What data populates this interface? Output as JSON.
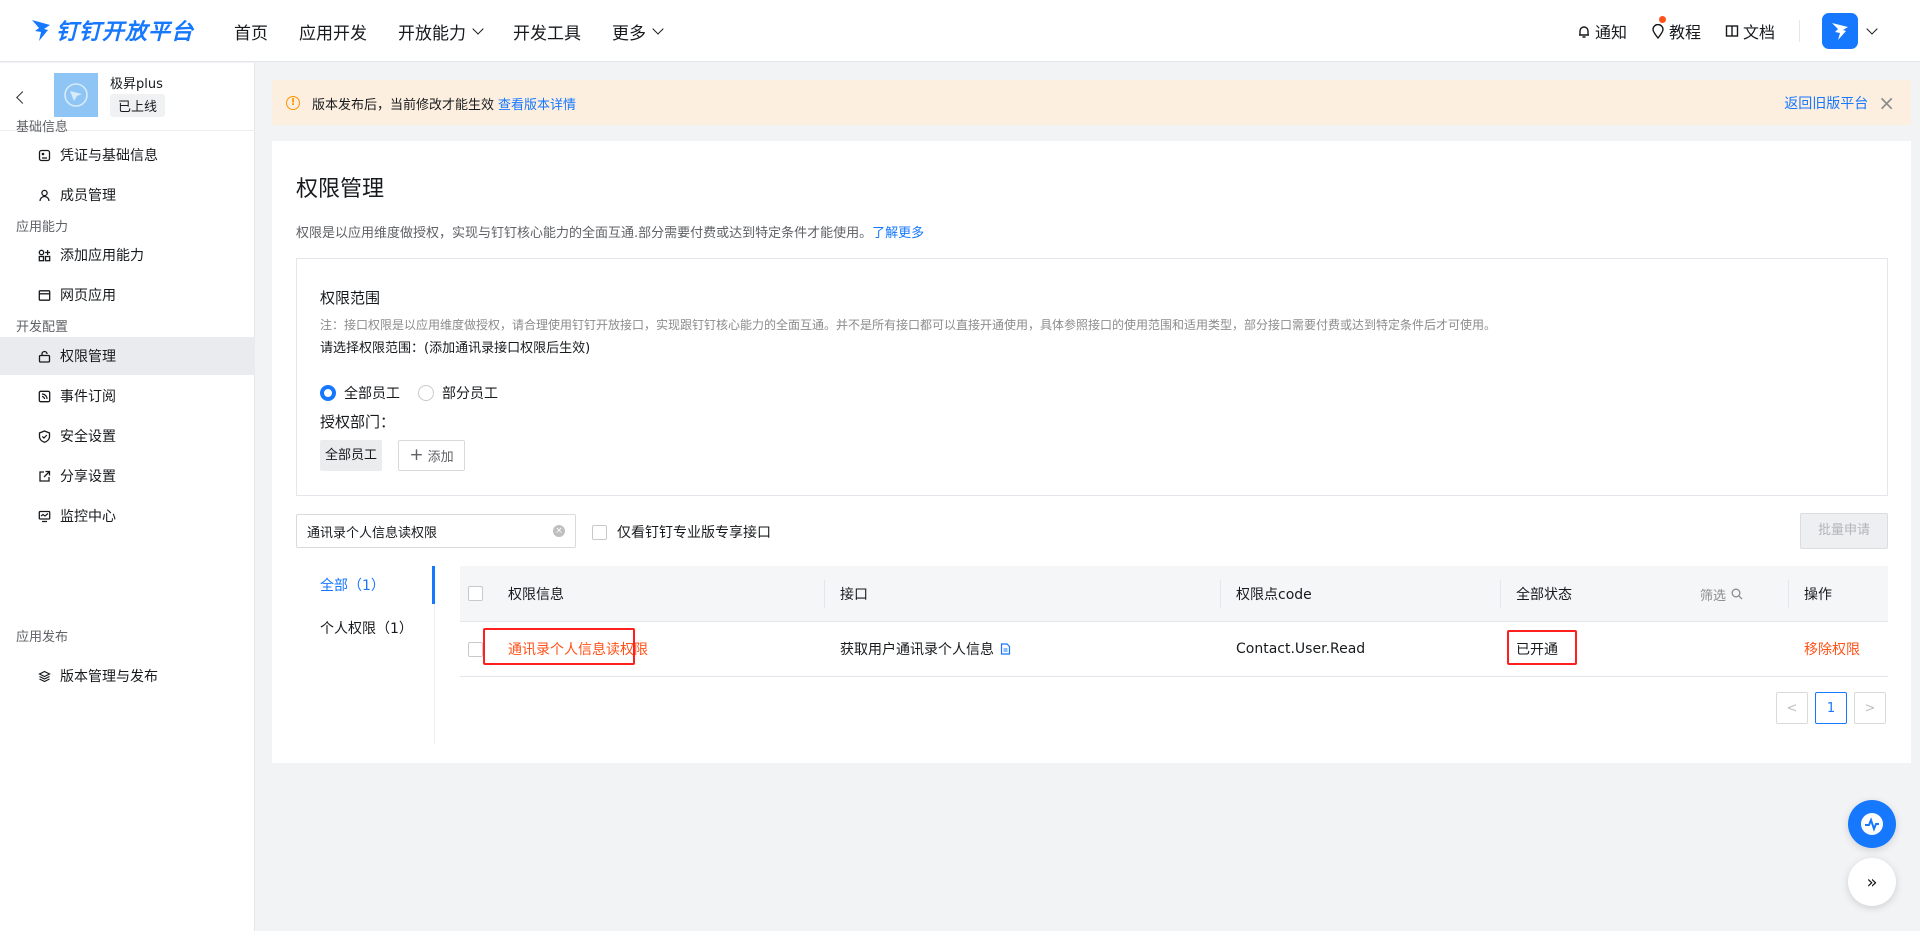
{
  "brand": {
    "name": "钉钉开放平台",
    "color": "#1677ff"
  },
  "topnav": {
    "items": [
      {
        "label": "首页",
        "has_dropdown": false
      },
      {
        "label": "应用开发",
        "has_dropdown": false
      },
      {
        "label": "开放能力",
        "has_dropdown": true
      },
      {
        "label": "开发工具",
        "has_dropdown": false
      },
      {
        "label": "更多",
        "has_dropdown": true
      }
    ],
    "right": {
      "notify": "通知",
      "tutorial": "教程",
      "docs": "文档"
    }
  },
  "sidebar": {
    "app_name": "极昇plus",
    "app_status": "已上线",
    "sections": [
      {
        "title": "基础信息",
        "items": [
          {
            "label": "凭证与基础信息",
            "icon": "credential-icon"
          },
          {
            "label": "成员管理",
            "icon": "user-icon"
          }
        ]
      },
      {
        "title": "应用能力",
        "items": [
          {
            "label": "添加应用能力",
            "icon": "apps-add-icon"
          },
          {
            "label": "网页应用",
            "icon": "browser-icon"
          }
        ]
      },
      {
        "title": "开发配置",
        "items": [
          {
            "label": "权限管理",
            "icon": "lock-icon",
            "active": true
          },
          {
            "label": "事件订阅",
            "icon": "rss-icon"
          },
          {
            "label": "安全设置",
            "icon": "shield-icon"
          },
          {
            "label": "分享设置",
            "icon": "share-icon"
          },
          {
            "label": "监控中心",
            "icon": "monitor-icon"
          }
        ]
      },
      {
        "title": "应用发布",
        "items": [
          {
            "label": "版本管理与发布",
            "icon": "layers-icon"
          }
        ]
      }
    ]
  },
  "banner": {
    "text": "版本发布后，当前修改才能生效",
    "link": "查看版本详情",
    "right_link": "返回旧版平台"
  },
  "page": {
    "title": "权限管理",
    "desc": "权限是以应用维度做授权，实现与钉钉核心能力的全面互通.部分需要付费或达到特定条件才能使用。",
    "desc_link": "了解更多"
  },
  "scope": {
    "title": "权限范围",
    "note": "注：接口权限是以应用维度做授权，请合理使用钉钉开放接口，实现跟钉钉核心能力的全面互通。并不是所有接口都可以直接开通使用，具体参照接口的使用范围和适用类型，部分接口需要付费或达到特定条件后才可使用。",
    "select_label": "请选择权限范围：(添加通讯录接口权限后生效)",
    "radio_all": "全部员工",
    "radio_part": "部分员工",
    "selected": "全部员工",
    "dept_label": "授权部门：",
    "dept_tag": "全部员工",
    "add_label": "添加"
  },
  "filters": {
    "search_value": "通讯录个人信息读权限",
    "only_pro_label": "仅看钉钉专业版专享接口",
    "batch_label": "批量申请"
  },
  "tabs": [
    {
      "label": "全部（1）",
      "active": true
    },
    {
      "label": "个人权限（1）",
      "active": false
    }
  ],
  "table": {
    "headers": {
      "info": "权限信息",
      "api": "接口",
      "code": "权限点code",
      "status": "全部状态",
      "filter": "筛选",
      "op": "操作"
    },
    "rows": [
      {
        "info": "通讯录个人信息读权限",
        "api": "获取用户通讯录个人信息",
        "code": "Contact.User.Read",
        "status": "已开通",
        "op": "移除权限"
      }
    ]
  },
  "pagination": {
    "prev": "<",
    "current": "1",
    "next": ">"
  }
}
